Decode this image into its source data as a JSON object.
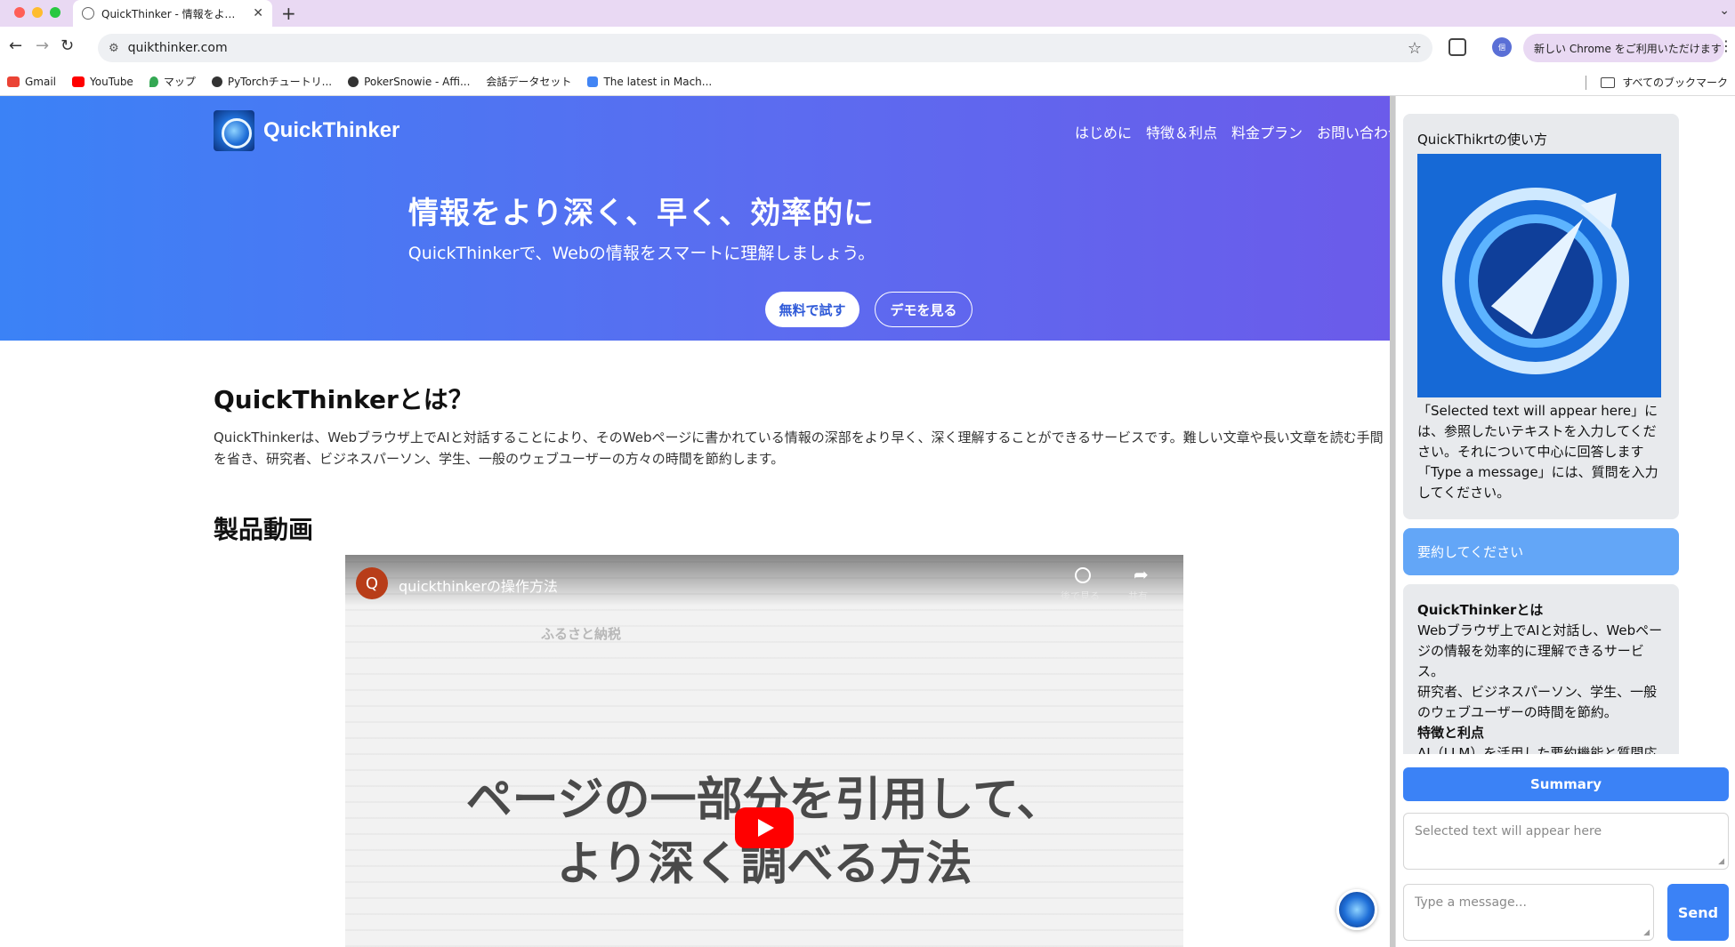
{
  "browser": {
    "tab_title": "QuickThinker - 情報をより深く",
    "url": "quikthinker.com",
    "update_label": "新しい Chrome をご利用いただけます",
    "profile_label": "個",
    "bookmarks": [
      {
        "label": "Gmail",
        "color": "#ea4335"
      },
      {
        "label": "YouTube",
        "color": "#ff0000"
      },
      {
        "label": "マップ",
        "color": "#34a853"
      },
      {
        "label": "PyTorchチュートリ...",
        "color": "#333333"
      },
      {
        "label": "PokerSnowie - Affi...",
        "color": "#333333"
      },
      {
        "label": "会話データセット",
        "color": "#ffffff"
      },
      {
        "label": "The latest in Mach...",
        "color": "#4285f4"
      }
    ],
    "all_bookmarks": "すべてのブックマーク"
  },
  "page": {
    "brand": "QuickThinker",
    "nav": [
      "はじめに",
      "特徴＆利点",
      "料金プラン",
      "お問い合わせ"
    ],
    "hero_title": "情報をより深く、早く、効率的に",
    "hero_subtitle": "QuickThinkerで、Webの情報をスマートに理解しましょう。",
    "cta_primary": "無料で試す",
    "cta_secondary": "デモを見る",
    "about_title": "QuickThinkerとは？",
    "about_body": "QuickThinkerは、Webブラウザ上でAIと対話することにより、そのWebページに書かれている情報の深部をより早く、深く理解することができるサービスです。難しい文章や長い文章を読む手間を省き、研究者、ビジネスパーソン、学生、一般のウェブユーザーの方々の時間を節約します。",
    "video_section_title": "製品動画",
    "video": {
      "channel_initial": "Q",
      "title": "quickthinkerの操作方法",
      "watch_later": "後で見る",
      "share": "共有",
      "doc_title": "ふるさと納税",
      "overlay_line1": "ページの一部分を引用して、",
      "overlay_line2": "より深く調べる方法"
    }
  },
  "sidepanel": {
    "help_title": "QuickThikrtの使い方",
    "help_text": "「Selected text will appear here」には、参照したいテキストを入力してください。それについて中心に回答します「Type a message」には、質問を入力してください。",
    "user_message": "要約してください",
    "reply_heading": "QuickThinkerとは",
    "reply_line1": "Webブラウザ上でAIと対話し、Webページの情報を効率的に理解できるサービス。",
    "reply_line2": "研究者、ビジネスパーソン、学生、一般のウェブユーザーの時間を節約。",
    "reply_heading2": "特徴と利点",
    "reply_line3": "AI（LLM）を活用した要約機能と質問応",
    "summary_button": "Summary",
    "selected_placeholder": "Selected text will appear here",
    "message_placeholder": "Type a message...",
    "send_button": "Send"
  }
}
